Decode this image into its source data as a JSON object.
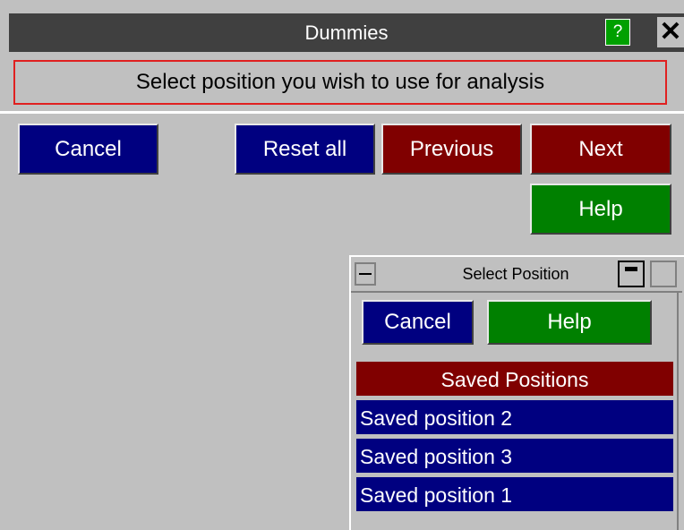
{
  "window": {
    "title": "Dummies",
    "help_glyph": "?",
    "close_glyph": "✕"
  },
  "prompt": "Select position you wish to use for analysis",
  "toolbar": {
    "cancel": "Cancel",
    "reset_all": "Reset all",
    "previous": "Previous",
    "next": "Next",
    "help": "Help"
  },
  "sub_window": {
    "title": "Select Position",
    "cancel": "Cancel",
    "help": "Help",
    "list_header": "Saved Positions",
    "items": [
      {
        "label": "Saved position 2"
      },
      {
        "label": "Saved position 3"
      },
      {
        "label": "Saved position 1"
      }
    ]
  },
  "colors": {
    "background": "#c0c0c0",
    "titlebar": "#404040",
    "blue_button": "#000080",
    "red_button": "#800000",
    "green_button": "#008000",
    "prompt_border": "#e02020"
  }
}
